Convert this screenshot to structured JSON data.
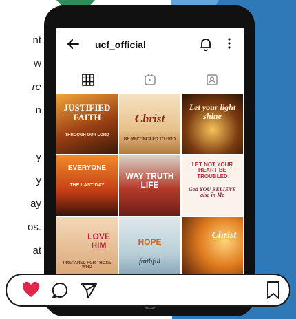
{
  "profile": {
    "username": "ucf_official"
  },
  "side_text": [
    "nt",
    "w",
    "re",
    "n",
    "",
    "y",
    "y",
    "ay",
    "os.",
    "at"
  ],
  "posts": [
    {
      "caption": "JUSTIFIED FAITH",
      "sub": "THROUGH OUR LORD"
    },
    {
      "caption": "Christ",
      "sub": "BE RECONCILED TO GOD"
    },
    {
      "caption": "Let your light shine",
      "sub": ""
    },
    {
      "caption": "EVERYONE",
      "sub": "THE LAST DAY"
    },
    {
      "caption": "WAY TRUTH LIFE",
      "sub": ""
    },
    {
      "caption": "LET NOT YOUR HEART BE TROUBLED",
      "sub": "God YOU BELIEVE also in Me"
    },
    {
      "caption": "LOVE HIM",
      "sub": "PREPARED FOR THOSE WHO"
    },
    {
      "caption": "HOPE",
      "sub": "faithful"
    },
    {
      "caption": "Christ",
      "sub": ""
    }
  ],
  "colors": {
    "accent_blue": "#2f79b8",
    "heart_red": "#e0284f",
    "phone_body": "#111111"
  },
  "icons": [
    "back-arrow-icon",
    "bell-icon",
    "more-icon",
    "grid-icon",
    "reels-icon",
    "tagged-icon",
    "heart-icon",
    "comment-icon",
    "share-icon",
    "bookmark-icon"
  ]
}
